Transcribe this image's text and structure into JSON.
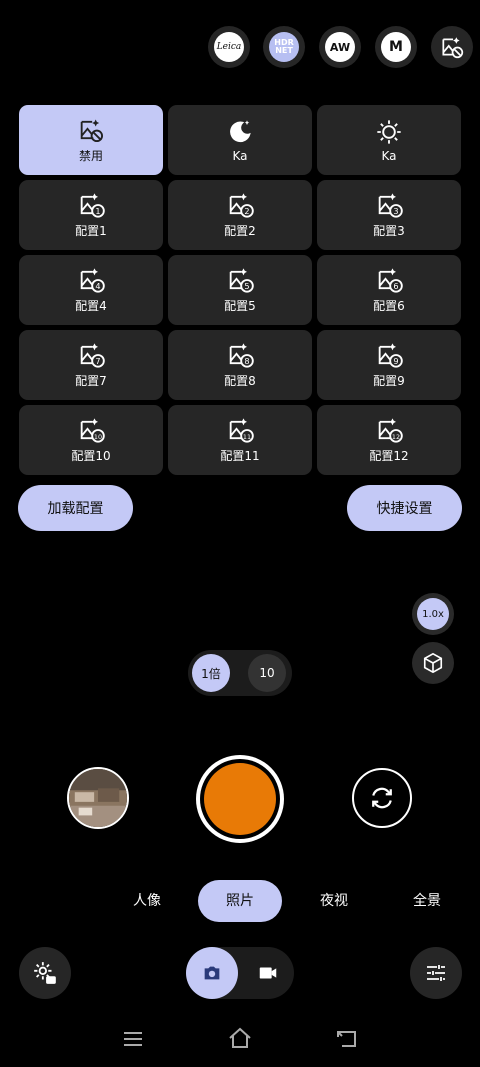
{
  "top_buttons": [
    {
      "label": "Leica",
      "icon": "leica-logo-icon"
    },
    {
      "label": "HDR",
      "label2": "NET",
      "icon": "hdr-net-icon"
    },
    {
      "label": "AW",
      "icon": "auto-white-balance-icon"
    },
    {
      "label": "M",
      "icon": "manual-mode-icon"
    },
    {
      "icon": "disable-effects-icon"
    }
  ],
  "grid": {
    "items": [
      {
        "label": "禁用",
        "badge": "",
        "active": true
      },
      {
        "label": "Ka",
        "badge": "",
        "icon": "night-ka-icon"
      },
      {
        "label": "Ka",
        "badge": "",
        "icon": "sun-ka-icon"
      },
      {
        "label": "配置1",
        "badge": "1"
      },
      {
        "label": "配置2",
        "badge": "2"
      },
      {
        "label": "配置3",
        "badge": "3"
      },
      {
        "label": "配置4",
        "badge": "4"
      },
      {
        "label": "配置5",
        "badge": "5"
      },
      {
        "label": "配置6",
        "badge": "6"
      },
      {
        "label": "配置7",
        "badge": "7"
      },
      {
        "label": "配置8",
        "badge": "8"
      },
      {
        "label": "配置9",
        "badge": "9"
      },
      {
        "label": "配置10",
        "badge": "10"
      },
      {
        "label": "配置11",
        "badge": "11"
      },
      {
        "label": "配置12",
        "badge": "12"
      }
    ]
  },
  "actions": {
    "load_config": "加载配置",
    "quick_settings": "快捷设置"
  },
  "lens": {
    "zoom_ratio": "1.0x"
  },
  "zoom_selector": {
    "option1": "1倍",
    "option2": "10"
  },
  "modes": [
    "人像",
    "照片",
    "夜视",
    "全景"
  ],
  "selected_mode": "照片",
  "colors": {
    "accent": "#c4c9f6",
    "shutter": "#e87a06"
  }
}
